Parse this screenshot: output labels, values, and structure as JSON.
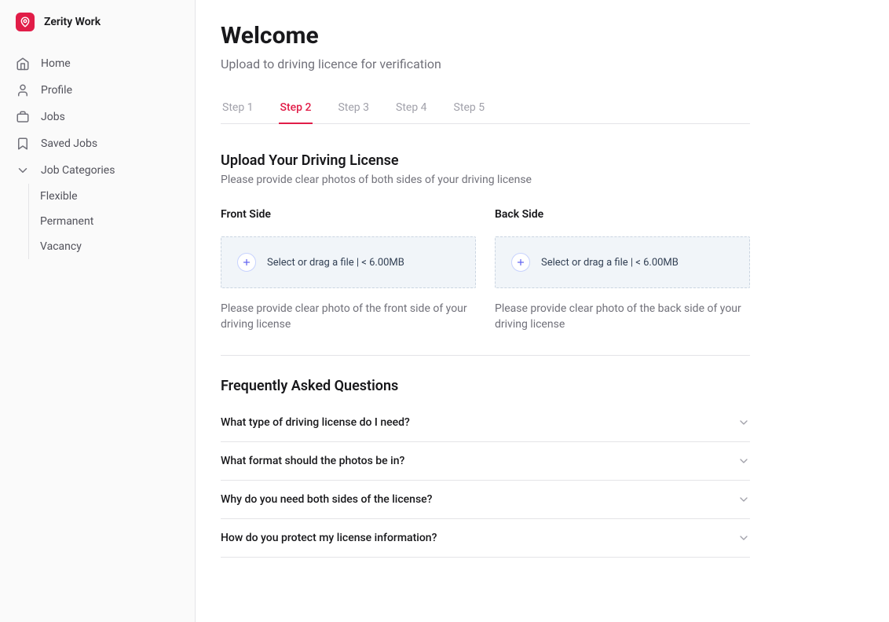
{
  "brand": {
    "name": "Zerity Work"
  },
  "sidebar": {
    "items": [
      {
        "label": "Home"
      },
      {
        "label": "Profile"
      },
      {
        "label": "Jobs"
      },
      {
        "label": "Saved Jobs"
      },
      {
        "label": "Job Categories"
      }
    ],
    "subItems": [
      {
        "label": "Flexible"
      },
      {
        "label": "Permanent"
      },
      {
        "label": "Vacancy"
      }
    ]
  },
  "page": {
    "title": "Welcome",
    "subtitle": "Upload to driving licence for verification"
  },
  "tabs": [
    {
      "label": "Step 1",
      "active": false
    },
    {
      "label": "Step 2",
      "active": true
    },
    {
      "label": "Step 3",
      "active": false
    },
    {
      "label": "Step 4",
      "active": false
    },
    {
      "label": "Step 5",
      "active": false
    }
  ],
  "upload": {
    "title": "Upload Your Driving License",
    "desc": "Please provide clear photos of both sides of your driving license",
    "front": {
      "label": "Front Side",
      "dropzoneText": "Select or drag a file | < 6.00MB",
      "hint": "Please provide clear photo of the front side of your driving license"
    },
    "back": {
      "label": "Back Side",
      "dropzoneText": "Select or drag a file | < 6.00MB",
      "hint": "Please provide clear photo of the back side of your driving license"
    }
  },
  "faq": {
    "title": "Frequently Asked Questions",
    "items": [
      {
        "q": "What type of driving license do I need?"
      },
      {
        "q": "What format should the photos be in?"
      },
      {
        "q": "Why do you need both sides of the license?"
      },
      {
        "q": "How do you protect my license information?"
      }
    ]
  }
}
